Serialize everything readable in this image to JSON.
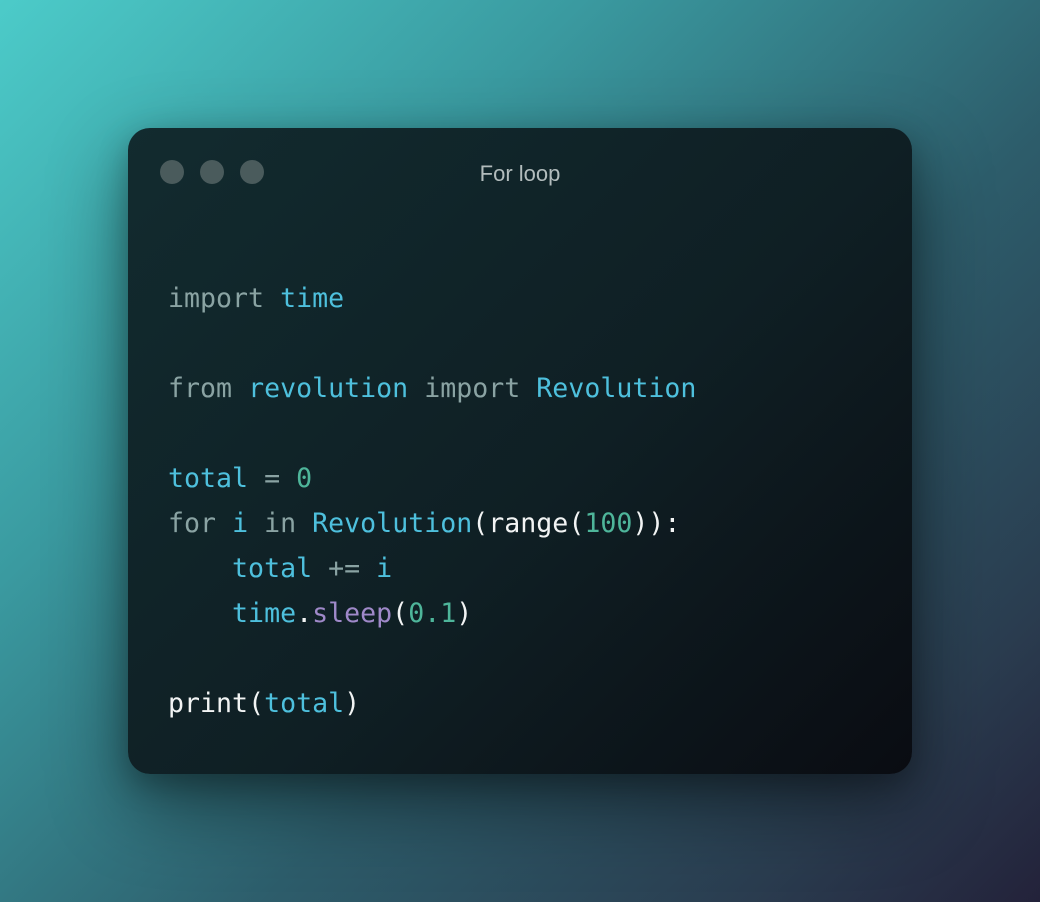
{
  "window": {
    "title": "For loop",
    "controls": [
      "close",
      "minimize",
      "maximize"
    ]
  },
  "code": {
    "language": "python",
    "lines": [
      [
        {
          "t": "import",
          "k": "kw"
        },
        {
          "t": " ",
          "k": "pl"
        },
        {
          "t": "time",
          "k": "id"
        }
      ],
      [],
      [
        {
          "t": "from",
          "k": "kw"
        },
        {
          "t": " ",
          "k": "pl"
        },
        {
          "t": "revolution",
          "k": "id"
        },
        {
          "t": " ",
          "k": "pl"
        },
        {
          "t": "import",
          "k": "kw"
        },
        {
          "t": " ",
          "k": "pl"
        },
        {
          "t": "Revolution",
          "k": "id"
        }
      ],
      [],
      [
        {
          "t": "total",
          "k": "id"
        },
        {
          "t": " ",
          "k": "pl"
        },
        {
          "t": "=",
          "k": "op"
        },
        {
          "t": " ",
          "k": "pl"
        },
        {
          "t": "0",
          "k": "num"
        }
      ],
      [
        {
          "t": "for",
          "k": "kw"
        },
        {
          "t": " ",
          "k": "pl"
        },
        {
          "t": "i",
          "k": "id"
        },
        {
          "t": " ",
          "k": "pl"
        },
        {
          "t": "in",
          "k": "kw"
        },
        {
          "t": " ",
          "k": "pl"
        },
        {
          "t": "Revolution",
          "k": "id"
        },
        {
          "t": "(",
          "k": "pl"
        },
        {
          "t": "range",
          "k": "pl"
        },
        {
          "t": "(",
          "k": "pl"
        },
        {
          "t": "100",
          "k": "num"
        },
        {
          "t": ")):",
          "k": "pl"
        }
      ],
      [
        {
          "t": "    ",
          "k": "pl"
        },
        {
          "t": "total",
          "k": "id"
        },
        {
          "t": " ",
          "k": "pl"
        },
        {
          "t": "+=",
          "k": "op"
        },
        {
          "t": " ",
          "k": "pl"
        },
        {
          "t": "i",
          "k": "id"
        }
      ],
      [
        {
          "t": "    ",
          "k": "pl"
        },
        {
          "t": "time",
          "k": "id"
        },
        {
          "t": ".",
          "k": "pl"
        },
        {
          "t": "sleep",
          "k": "fn"
        },
        {
          "t": "(",
          "k": "pl"
        },
        {
          "t": "0.1",
          "k": "num"
        },
        {
          "t": ")",
          "k": "pl"
        }
      ],
      [],
      [
        {
          "t": "print",
          "k": "pl"
        },
        {
          "t": "(",
          "k": "pl"
        },
        {
          "t": "total",
          "k": "id"
        },
        {
          "t": ")",
          "k": "pl"
        }
      ]
    ]
  },
  "colors": {
    "keyword": "#8aa3a3",
    "identifier": "#4ec0dd",
    "number": "#4eb59a",
    "method": "#9f89c9",
    "plain": "#f2f4f4",
    "window_bg": "#0f1f24",
    "window_dot": "#4a5b5c"
  }
}
